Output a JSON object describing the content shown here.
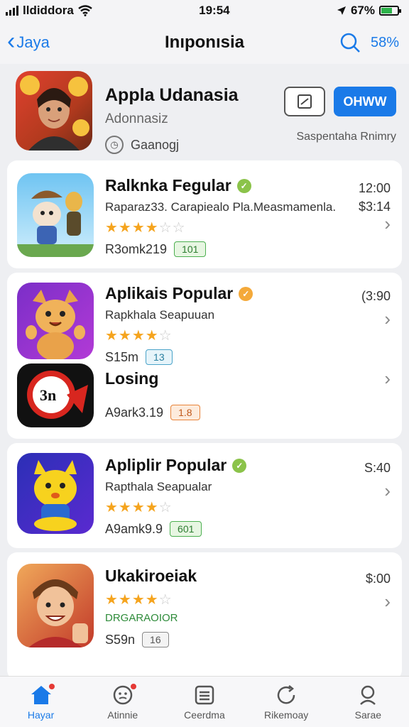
{
  "status": {
    "carrier": "lldiddora",
    "time": "19:54",
    "battery": "67%",
    "battery_level": 0.67
  },
  "nav": {
    "back_label": "Jaya",
    "title": "Inıponısia",
    "right_label": "58%"
  },
  "header": {
    "title": "Appla Udanasia",
    "subtitle": "Adonnasiz",
    "meta": "Gaanogj",
    "action_label": "OHWW",
    "right_text": "Saspentaha Rnimry"
  },
  "rows": [
    {
      "title": "Ralknka Fegular",
      "subtitle": "Raparaz33. Carapiealo Pla.Measmamenla.",
      "rating": 4,
      "bottom": "R3omk219",
      "pill": "101",
      "price1": "12:00",
      "price2": "$3:14",
      "verified_color": "#8bc34a",
      "pill_color": "#4caf50"
    },
    {
      "title": "Aplikais Popular",
      "subtitle": "Rapkhala Seapuuan",
      "rating": 4,
      "bottom": "S15m",
      "pill": "13",
      "price1": "(3:90",
      "price2": "",
      "verified_color": "#f4a93a",
      "pill_color": "#4aa3c9"
    },
    {
      "title": "Losing",
      "subtitle": "",
      "rating": 0,
      "bottom": "A9ark3.19",
      "pill": "1.8",
      "price1": "",
      "price2": "",
      "verified_color": "",
      "pill_color": "#e8843a"
    },
    {
      "title": "Apliplir Popular",
      "subtitle": "Rapthala Seapualar",
      "rating": 4,
      "bottom": "A9amk9.9",
      "pill": "601",
      "price1": "S:40",
      "price2": "",
      "verified_color": "#8bc34a",
      "pill_color": "#4caf50"
    },
    {
      "title": "Ukakiroeiak",
      "subtitle": "DRGARAOIOR",
      "rating": 4,
      "bottom": "S59n",
      "pill": "16",
      "price1": "$:00",
      "price2": "",
      "verified_color": "",
      "pill_color": "#777"
    }
  ],
  "tabs": [
    {
      "label": "Hayar",
      "icon": "home-icon"
    },
    {
      "label": "Atinnie",
      "icon": "games-icon"
    },
    {
      "label": "Ceerdma",
      "icon": "apps-icon"
    },
    {
      "label": "Rikemoay",
      "icon": "refresh-icon"
    },
    {
      "label": "Sarae",
      "icon": "search-icon"
    }
  ]
}
